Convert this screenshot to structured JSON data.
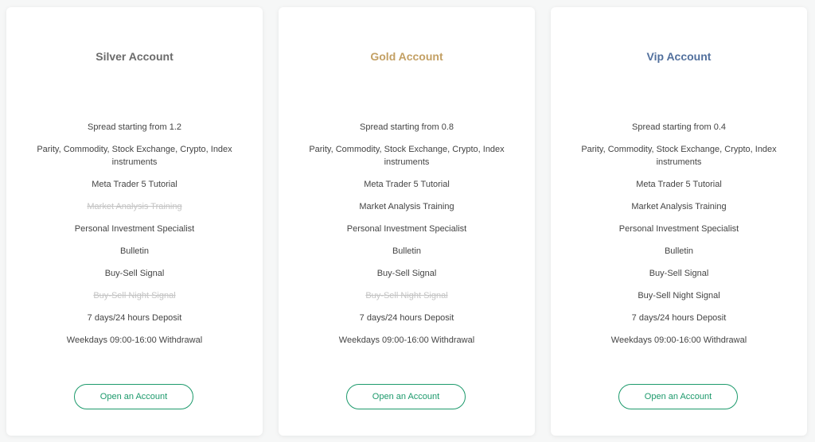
{
  "colors": {
    "silver": "#6b6b6b",
    "gold": "#c3a064",
    "vip": "#52709d",
    "accent": "#1d9a6c",
    "disabled": "#c4c4c4"
  },
  "cards": [
    {
      "title": "Silver Account",
      "features": [
        {
          "text": "Spread starting from 1.2",
          "disabled": false
        },
        {
          "text": "Parity, Commodity, Stock Exchange, Crypto, Index instruments",
          "disabled": false
        },
        {
          "text": "Meta Trader 5 Tutorial",
          "disabled": false
        },
        {
          "text": "Market Analysis Training",
          "disabled": true
        },
        {
          "text": "Personal Investment Specialist",
          "disabled": false
        },
        {
          "text": "Bulletin",
          "disabled": false
        },
        {
          "text": "Buy-Sell Signal",
          "disabled": false
        },
        {
          "text": "Buy-Sell Night Signal",
          "disabled": true
        },
        {
          "text": "7 days/24 hours Deposit",
          "disabled": false
        },
        {
          "text": "Weekdays 09:00-16:00 Withdrawal",
          "disabled": false
        }
      ],
      "button_label": "Open an Account"
    },
    {
      "title": "Gold Account",
      "features": [
        {
          "text": "Spread starting from 0.8",
          "disabled": false
        },
        {
          "text": "Parity, Commodity, Stock Exchange, Crypto, Index instruments",
          "disabled": false
        },
        {
          "text": "Meta Trader 5 Tutorial",
          "disabled": false
        },
        {
          "text": "Market Analysis Training",
          "disabled": false
        },
        {
          "text": "Personal Investment Specialist",
          "disabled": false
        },
        {
          "text": "Bulletin",
          "disabled": false
        },
        {
          "text": "Buy-Sell Signal",
          "disabled": false
        },
        {
          "text": "Buy-Sell Night Signal",
          "disabled": true
        },
        {
          "text": "7 days/24 hours Deposit",
          "disabled": false
        },
        {
          "text": "Weekdays 09:00-16:00 Withdrawal",
          "disabled": false
        }
      ],
      "button_label": "Open an Account"
    },
    {
      "title": "Vip Account",
      "features": [
        {
          "text": "Spread starting from 0.4",
          "disabled": false
        },
        {
          "text": "Parity, Commodity, Stock Exchange, Crypto, Index instruments",
          "disabled": false
        },
        {
          "text": "Meta Trader 5 Tutorial",
          "disabled": false
        },
        {
          "text": "Market Analysis Training",
          "disabled": false
        },
        {
          "text": "Personal Investment Specialist",
          "disabled": false
        },
        {
          "text": "Bulletin",
          "disabled": false
        },
        {
          "text": "Buy-Sell Signal",
          "disabled": false
        },
        {
          "text": "Buy-Sell Night Signal",
          "disabled": false
        },
        {
          "text": "7 days/24 hours Deposit",
          "disabled": false
        },
        {
          "text": "Weekdays 09:00-16:00 Withdrawal",
          "disabled": false
        }
      ],
      "button_label": "Open an Account"
    }
  ]
}
